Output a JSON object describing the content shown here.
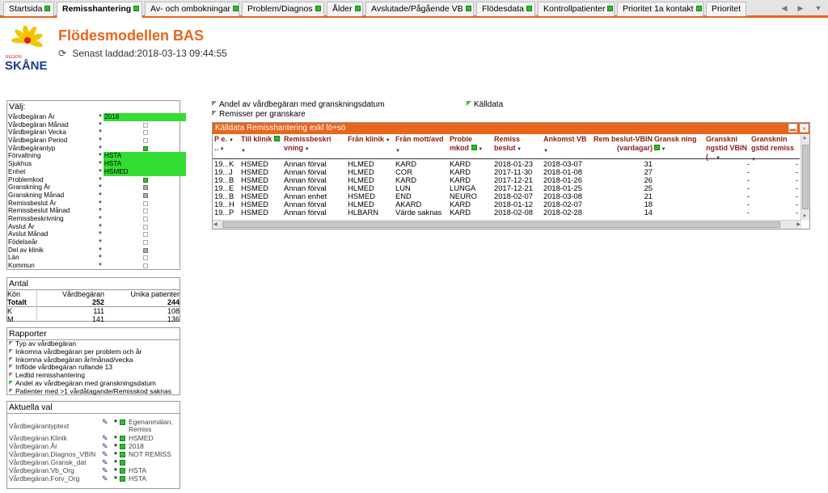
{
  "tabs": [
    {
      "label": "Startsida",
      "has_dot": true
    },
    {
      "label": "Remisshantering",
      "has_dot": true
    },
    {
      "label": "Av- och ombokningar",
      "has_dot": true
    },
    {
      "label": "Problem/Diagnos",
      "has_dot": true
    },
    {
      "label": "Ålder",
      "has_dot": true
    },
    {
      "label": "Avslutade/Pågående VB",
      "has_dot": true
    },
    {
      "label": "Flödesdata",
      "has_dot": true
    },
    {
      "label": "Kontrollpatienter",
      "has_dot": true
    },
    {
      "label": "Prioritet 1a kontakt",
      "has_dot": true
    },
    {
      "label": "Prioritet",
      "has_dot": false
    }
  ],
  "active_tab": "Remisshantering",
  "logo": {
    "region": "REGION",
    "name": "SKÅNE"
  },
  "header": {
    "title": "Flödesmodellen BAS",
    "loaded": "Senast laddad:2018-03-13 09:44:55"
  },
  "valj": {
    "title": "Välj:",
    "rows": [
      {
        "label": "Vårdbegäran År",
        "value": "2018",
        "state": "selected"
      },
      {
        "label": "Vårdbegäran Månad",
        "value": "",
        "state": "empty"
      },
      {
        "label": "Vårdbegäran Vecka",
        "value": "",
        "state": "empty"
      },
      {
        "label": "Vårdbegäran Period",
        "value": "",
        "state": "empty"
      },
      {
        "label": "Vårdbegärantyp",
        "value": "",
        "state": "green"
      },
      {
        "label": "Förvaltning",
        "value": "HSTA",
        "state": "selected"
      },
      {
        "label": "Sjukhus",
        "value": "HSTA",
        "state": "selected"
      },
      {
        "label": "Enhet",
        "value": "HSMED",
        "state": "selected"
      },
      {
        "label": "Problemkod",
        "value": "",
        "state": "green"
      },
      {
        "label": "Granskning År",
        "value": "",
        "state": "gray"
      },
      {
        "label": "Granskning Månad",
        "value": "",
        "state": "gray"
      },
      {
        "label": "Remissbeslut År",
        "value": "",
        "state": "empty"
      },
      {
        "label": "Remissbeslut Månad",
        "value": "",
        "state": "empty"
      },
      {
        "label": "Remissbeskrivning",
        "value": "",
        "state": "empty"
      },
      {
        "label": "Avslut År",
        "value": "",
        "state": "empty"
      },
      {
        "label": "Avslut Månad",
        "value": "",
        "state": "empty"
      },
      {
        "label": "Födelseår",
        "value": "",
        "state": "empty"
      },
      {
        "label": "Del av klinik",
        "value": "",
        "state": "gray"
      },
      {
        "label": "Län",
        "value": "",
        "state": "empty"
      },
      {
        "label": "Kommun",
        "value": "",
        "state": "empty"
      }
    ]
  },
  "antal": {
    "title": "Antal",
    "col_kon": "Kön",
    "col_vb": "Vårdbegäran",
    "col_unika": "Unika patienter",
    "rows": [
      {
        "kon": "Totalt",
        "vb": "252",
        "unika": "244"
      },
      {
        "kon": "K",
        "vb": "111",
        "unika": "108"
      },
      {
        "kon": "M",
        "vb": "141",
        "unika": "136"
      }
    ]
  },
  "rapporter": {
    "title": "Rapporter",
    "items": [
      {
        "label": "Typ av vårdbegäran",
        "green": false
      },
      {
        "label": "Inkomna vårdbegäran per problem och år",
        "green": false
      },
      {
        "label": "Inkomna vårdbegäran år/månad/vecka",
        "green": false
      },
      {
        "label": "Inflöde vårdbegäran rullande 13",
        "green": false
      },
      {
        "label": "Ledtid remisshantering",
        "green": false
      },
      {
        "label": "Andel av vårdbegäran med granskningsdatum",
        "green": true
      },
      {
        "label": "Patienter med >1 vårdåtagande/Remisskod saknas",
        "green": false
      }
    ]
  },
  "aktuella": {
    "title": "Aktuella val",
    "rows": [
      {
        "label": "Vårdbegärantyptext",
        "value": "Egenanmälan, Remiss"
      },
      {
        "label": "Vårdbegäran.Klinik",
        "value": "HSMED"
      },
      {
        "label": "Vårdbegäran.År",
        "value": "2018"
      },
      {
        "label": "Vårdbegäran.Diagnos_VBIN",
        "value": "NOT REMISS"
      },
      {
        "label": "Vårdbegäran.Gransk_dat",
        "value": ""
      },
      {
        "label": "Vårdbegäran.Vb_Org",
        "value": "HSTA"
      },
      {
        "label": "Vårdbegäran.Forv_Org",
        "value": "HSTA"
      }
    ]
  },
  "report_tabs": [
    {
      "label": "Andel av vårdbegäran med granskningsdatum",
      "green": false
    },
    {
      "label": "Källdata",
      "green": true
    },
    {
      "label": "Remisser per granskare",
      "green": false
    }
  ],
  "grid": {
    "title": "Källdata Remisshantering exkl lö+sö",
    "headers": [
      {
        "label": "P e. ..",
        "sort": true,
        "dot": false
      },
      {
        "label": "",
        "sort": true,
        "dot": false
      },
      {
        "label": "Till klinik",
        "sort": true,
        "dot": true
      },
      {
        "label": "Remissbeskri vning",
        "sort": true,
        "dot": false
      },
      {
        "label": "Från klinik",
        "sort": true,
        "dot": false
      },
      {
        "label": "Från mott/avd",
        "sort": true,
        "dot": false
      },
      {
        "label": "Proble mkod",
        "sort": true,
        "dot": true
      },
      {
        "label": "Remiss beslut",
        "sort": true,
        "dot": false
      },
      {
        "label": "Ankomst VB",
        "sort": true,
        "dot": false
      },
      {
        "label": "Rem beslut-VBIN (vardagar)",
        "sort": false,
        "dot": false
      },
      {
        "label": "Gransk ning",
        "sort": true,
        "dot": true
      },
      {
        "label": "Granskni ngstid VBIN (...",
        "sort": true,
        "dot": false
      },
      {
        "label": "Gransknin gstid remiss",
        "sort": true,
        "dot": false
      }
    ],
    "rows": [
      [
        "19...",
        "K",
        "HSMED",
        "Annan förval",
        "HLMED",
        "KARD",
        "KARD",
        "2018-01-23",
        "2018-03-07",
        "31",
        "",
        "-",
        "-"
      ],
      [
        "19...",
        "J",
        "HSMED",
        "Annan förval",
        "HLMED",
        "COR",
        "KARD",
        "2017-11-30",
        "2018-01-08",
        "27",
        "",
        "-",
        "-"
      ],
      [
        "19...",
        "B",
        "HSMED",
        "Annan förval",
        "HLMED",
        "KARD",
        "KARD",
        "2017-12-21",
        "2018-01-26",
        "26",
        "",
        "-",
        "-"
      ],
      [
        "19...",
        "E",
        "HSMED",
        "Annan förval",
        "HLMED",
        "LUN",
        "LUNGA",
        "2017-12-21",
        "2018-01-25",
        "25",
        "",
        "-",
        "-"
      ],
      [
        "19...",
        "B",
        "HSMED",
        "Annan enhet",
        "HSMED",
        "END",
        "NEURO",
        "2018-02-07",
        "2018-03-08",
        "21",
        "",
        "-",
        "-"
      ],
      [
        "19...",
        "H",
        "HSMED",
        "Annan förval",
        "HLMED",
        "AKARD",
        "KARD",
        "2018-01-12",
        "2018-02-07",
        "18",
        "",
        "-",
        "-"
      ],
      [
        "19...",
        "P",
        "HSMED",
        "Annan förval",
        "HLBARN",
        "Värde saknas",
        "KARD",
        "2018-02-08",
        "2018-02-28",
        "14",
        "",
        "-",
        "-"
      ]
    ]
  }
}
